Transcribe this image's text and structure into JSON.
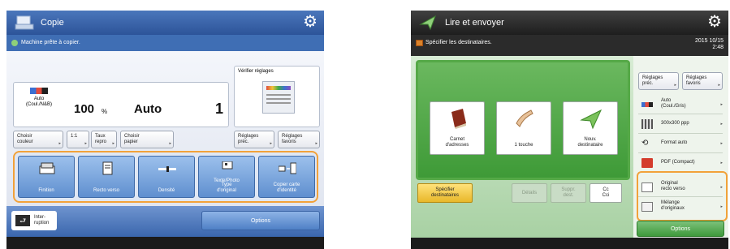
{
  "copy": {
    "title": "Copie",
    "status": "Machine prête à copier.",
    "color_mode_value": "Auto\n(Coul./N&B)",
    "zoom_value": "100",
    "zoom_unit": "%",
    "paper_value": "Auto",
    "copies_value": "1",
    "check_settings_label": "Vérifier réglages",
    "buttons": {
      "choose_color": "Choisir\ncouleur",
      "one_to_one": "1:1",
      "ratio": "Taux\nrepro",
      "choose_paper": "Choisir\npapier",
      "prev_settings": "Réglages\npréc.",
      "favorite_settings": "Réglages\nfavoris"
    },
    "functions": [
      {
        "label": "Finition",
        "icon": "finisher-icon"
      },
      {
        "label": "Recto verso",
        "icon": "duplex-icon"
      },
      {
        "label": "Densité",
        "icon": "density-icon"
      },
      {
        "label": "Type\nd'original",
        "icon": "original-type-icon",
        "sub": "Texte/Photo"
      },
      {
        "label": "Copier carte\nd'identité",
        "icon": "id-card-icon"
      }
    ],
    "interrupt_label": "Inter-\nruption",
    "options_label": "Options"
  },
  "send": {
    "title": "Lire et envoyer",
    "status": "Spécifier les destinataires.",
    "date": "2015 10/15",
    "time": "2:48",
    "destinations": [
      {
        "label": "Carnet\nd'adresses",
        "icon": "address-book-icon"
      },
      {
        "label": "1 touche",
        "icon": "one-touch-icon"
      },
      {
        "label": "Nouv.\ndestinataire",
        "icon": "new-destination-icon"
      }
    ],
    "tabs": {
      "specify": "Spécifier\ndestinataires",
      "details": "Détails",
      "delete": "Suppr.\ndest.",
      "cc_cci": "Cc\nCci"
    },
    "side": {
      "prev_settings": "Réglages\npréc.",
      "favorite_settings": "Réglages\nfavoris",
      "color": "Auto\n(Coul./Gris)",
      "resolution": "300x300 ppp",
      "format": "Format auto",
      "file_format": "PDF (Compact)",
      "original": "Original\nrecto verso",
      "mixed": "Mélange\nd'originaux"
    },
    "options_label": "Options"
  },
  "colors": {
    "copy_accent": "#4a76bb",
    "send_accent": "#3e9a37",
    "highlight": "#f2a23a"
  }
}
